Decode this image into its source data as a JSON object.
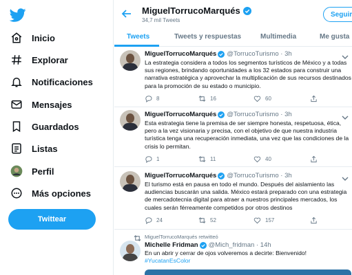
{
  "colors": {
    "accent": "#1da1f2",
    "text": "#0f1419",
    "muted": "#657786",
    "border": "#e6ecf0"
  },
  "nav": {
    "logo_icon": "twitter-bird-icon",
    "items": [
      {
        "label": "Inicio",
        "icon": "home-icon"
      },
      {
        "label": "Explorar",
        "icon": "hashtag-icon"
      },
      {
        "label": "Notificaciones",
        "icon": "bell-icon"
      },
      {
        "label": "Mensajes",
        "icon": "mail-icon"
      },
      {
        "label": "Guardados",
        "icon": "bookmark-icon"
      },
      {
        "label": "Listas",
        "icon": "list-icon"
      },
      {
        "label": "Perfil",
        "icon": "avatar-icon"
      },
      {
        "label": "Más opciones",
        "icon": "more-icon"
      }
    ],
    "tweet_button": "Twittear"
  },
  "header": {
    "name": "MiguelTorrucoMarqués",
    "tweet_count": "34,7 mil Tweets",
    "follow_label": "Seguir"
  },
  "tabs": [
    {
      "label": "Tweets",
      "active": true
    },
    {
      "label": "Tweets y respuestas",
      "active": false
    },
    {
      "label": "Multimedia",
      "active": false
    },
    {
      "label": "Me gusta",
      "active": false
    }
  ],
  "tweets": [
    {
      "name": "MiguelTorrucoMarqués",
      "handle": "@TorrucoTurismo · 3h",
      "text": "La estrategia considera a todos los segmentos turísticos de México y a todas sus regiones, brindando oportunidades a los 32 estados para construir una narrativa estratégica y aprovechar la multiplicación de sus recursos destinados para la promoción de su estado o municipio.",
      "replies": "8",
      "retweets": "16",
      "likes": "60"
    },
    {
      "name": "MiguelTorrucoMarqués",
      "handle": "@TorrucoTurismo · 3h",
      "text": "Esta estrategia tiene la premisa de ser siempre honesta, respetuosa, ética, pero a la vez visionaria y precisa, con el objetivo de que nuestra industria turística tenga una recuperación inmediata, una vez que las condiciones de la crisis lo permitan.",
      "replies": "1",
      "retweets": "11",
      "likes": "40"
    },
    {
      "name": "MiguelTorrucoMarqués",
      "handle": "@TorrucoTurismo · 3h",
      "text": "El turismo está en pausa en todo el mundo. Después del aislamiento las audiencias buscarán una salida. México estará preparado con una estrategia de mercadotecnia digital para atraer a nuestros principales mercados, los cuales serán férreamente competidos por otros destinos",
      "replies": "24",
      "retweets": "52",
      "likes": "157"
    },
    {
      "retweeted_by": "MiguelTorrucoMarqués retwitteó",
      "name": "Michelle Fridman",
      "handle": "@Mich_fridman · 14h",
      "text": "En un abrir y cerrar de ojos volveremos a decirte: Bienvenido!",
      "hashtag": "#YucatanEsColor"
    }
  ]
}
